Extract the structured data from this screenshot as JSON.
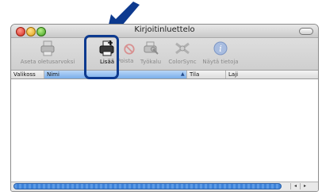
{
  "window": {
    "title": "Kirjoitinluettelo"
  },
  "toolbar": {
    "items": [
      {
        "label": "Aseta oletusarvoksi",
        "icon": "printer-default-icon"
      },
      {
        "label": "Lisää",
        "icon": "printer-add-icon"
      },
      {
        "label": "Poista",
        "icon": "delete-icon"
      },
      {
        "label": "Työkalu",
        "icon": "printer-utility-icon"
      },
      {
        "label": "ColorSync",
        "icon": "colorsync-icon"
      },
      {
        "label": "Näytä tietoja",
        "icon": "info-icon"
      }
    ]
  },
  "table": {
    "columns": [
      "Valikoss",
      "Nimi",
      "Tila",
      "Laji"
    ],
    "sorted_column": "Nimi"
  },
  "colors": {
    "accent": "#0d3a8f",
    "selection": "#7aaeea"
  }
}
